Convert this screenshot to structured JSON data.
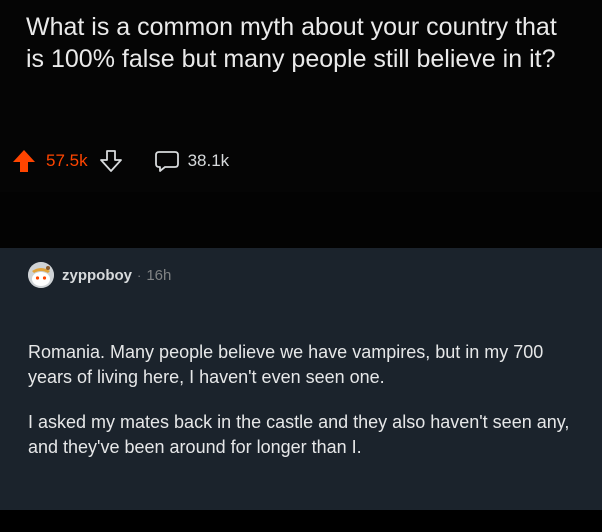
{
  "post": {
    "title": "What is a common myth about your country that is 100% false but many people still believe in it?",
    "upvotes": "57.5k",
    "comments": "38.1k"
  },
  "comment": {
    "username": "zyppoboy",
    "separator": "·",
    "timestamp": "16h",
    "paragraphs": [
      "Romania. Many people believe we have vampires, but in my 700 years of living here, I haven't even seen one.",
      "I asked my mates back in the castle and they also haven't seen any, and they've been around for longer than I."
    ]
  },
  "colors": {
    "upvote_active": "#ff4500",
    "comment_card_bg": "#1b232c",
    "text_primary": "#d7dadc",
    "text_muted": "#818384"
  },
  "icons": {
    "upvote": "upvote-arrow-icon",
    "downvote": "downvote-arrow-icon",
    "comments": "speech-bubble-icon",
    "avatar": "snoo-avatar-icon"
  }
}
